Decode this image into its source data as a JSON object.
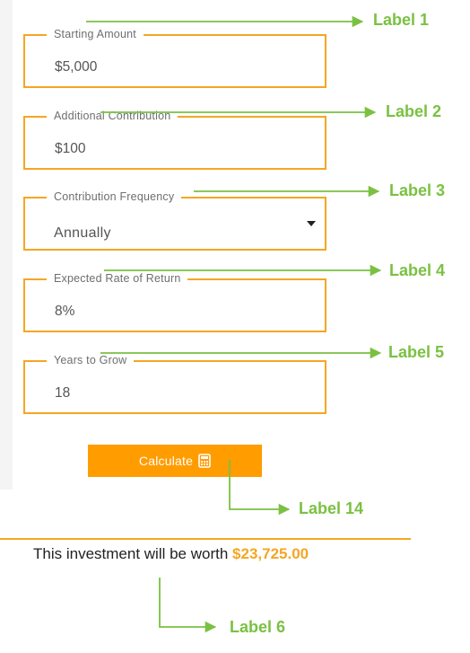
{
  "form": {
    "fields": [
      {
        "label": "Starting Amount",
        "value": "$5,000"
      },
      {
        "label": "Additional Contribution",
        "value": "$100"
      },
      {
        "label": "Contribution Frequency",
        "value": "Annually"
      },
      {
        "label": "Expected Rate of Return",
        "value": "8%"
      },
      {
        "label": "Years to Grow",
        "value": "18"
      }
    ],
    "calculate_label": "Calculate"
  },
  "result": {
    "text": "This investment will be worth",
    "value": "$23,725.00"
  },
  "annotations": {
    "label_1": "Label 1",
    "label_2": "Label 2",
    "label_3": "Label 3",
    "label_4": "Label 4",
    "label_5": "Label 5",
    "label_14": "Label 14",
    "label_6": "Label 6"
  },
  "colors": {
    "field_border": "#f5a623",
    "button_bg": "#ff9c00",
    "result_value": "#f5a623",
    "annotation": "#7ac142"
  },
  "icons": {
    "calculate": "calculator-icon",
    "frequency": "caret-down-icon",
    "annotation": "arrow-right-icon"
  }
}
